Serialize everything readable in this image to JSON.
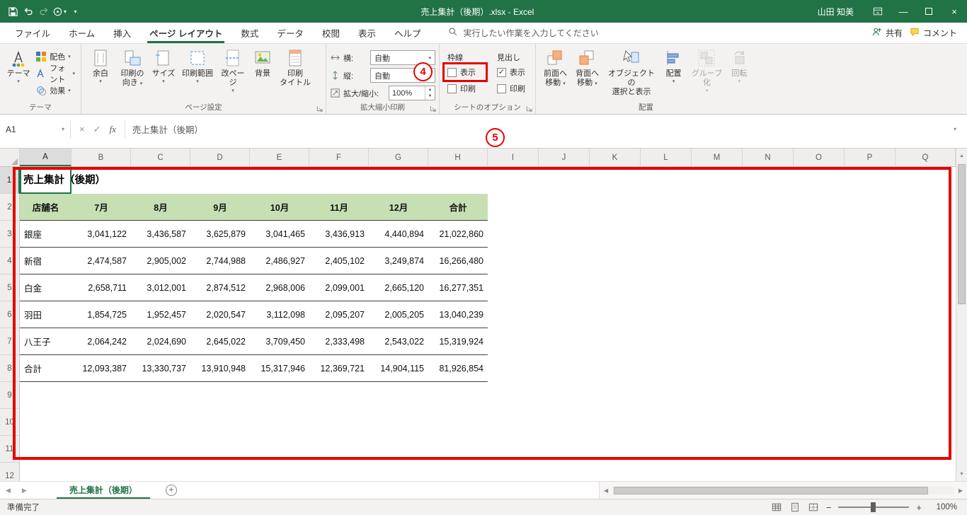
{
  "icons": {
    "caret": "▾",
    "up": "▲",
    "down": "▼",
    "left": "◀",
    "right": "▶",
    "plus": "+",
    "check": "✓",
    "cancel": "×",
    "fx": "fx",
    "minimize": "—",
    "close": "×"
  },
  "title_bar": {
    "title": "売上集計（後期）.xlsx  -  Excel",
    "user_name": "山田 知美"
  },
  "menu": {
    "tabs": [
      "ファイル",
      "ホーム",
      "挿入",
      "ページ レイアウト",
      "数式",
      "データ",
      "校閲",
      "表示",
      "ヘルプ"
    ],
    "active_tab": "ページ レイアウト",
    "search_placeholder": "実行したい作業を入力してください",
    "share": "共有",
    "comments": "コメント"
  },
  "ribbon": {
    "theme_group": {
      "label": "テーマ",
      "theme_button": "テーマ",
      "colors": "配色",
      "fonts": "フォント",
      "effects": "効果"
    },
    "page_setup_group": {
      "label": "ページ設定",
      "margins": "余白",
      "orientation_1": "印刷の",
      "orientation_2": "向き",
      "size": "サイズ",
      "print_area": "印刷範囲",
      "breaks": "改ページ",
      "background": "背景",
      "print_titles_1": "印刷",
      "print_titles_2": "タイトル"
    },
    "scale_group": {
      "label": "拡大縮小印刷",
      "width_label": "横:",
      "width_value": "自動",
      "height_label": "縦:",
      "height_value": "自動",
      "scale_label": "拡大/縮小:",
      "scale_value": "100%"
    },
    "sheet_options_group": {
      "label": "シートのオプション",
      "gridlines_label": "枠線",
      "headings_label": "見出し",
      "view_label": "表示",
      "print_label": "印刷",
      "gridlines_view_checked": false,
      "gridlines_print_checked": false,
      "headings_view_checked": true,
      "headings_print_checked": false
    },
    "arrange_group": {
      "label": "配置",
      "bring_forward_1": "前面へ",
      "bring_forward_2": "移動",
      "send_backward_1": "背面へ",
      "send_backward_2": "移動",
      "selection_pane_1": "オブジェクトの",
      "selection_pane_2": "選択と表示",
      "align": "配置",
      "group": "グループ化",
      "rotate": "回転"
    }
  },
  "formula_bar": {
    "name_box": "A1",
    "formula": "売上集計（後期）"
  },
  "grid": {
    "columns": [
      "A",
      "B",
      "C",
      "D",
      "E",
      "F",
      "G",
      "H",
      "I",
      "J",
      "K",
      "L",
      "M",
      "N",
      "O",
      "P",
      "Q"
    ],
    "row_count": 12,
    "selected_cell": "A1",
    "selected_column": "A",
    "selected_row": "1",
    "title_cell_text": "売上集計（後期）",
    "header_fill": "#c6e0b4",
    "table": {
      "header": [
        "店舗名",
        "7月",
        "8月",
        "9月",
        "10月",
        "11月",
        "12月",
        "合計"
      ],
      "rows": [
        [
          "銀座",
          "3,041,122",
          "3,436,587",
          "3,625,879",
          "3,041,465",
          "3,436,913",
          "4,440,894",
          "21,022,860"
        ],
        [
          "新宿",
          "2,474,587",
          "2,905,002",
          "2,744,988",
          "2,486,927",
          "2,405,102",
          "3,249,874",
          "16,266,480"
        ],
        [
          "白金",
          "2,658,711",
          "3,012,001",
          "2,874,512",
          "2,968,006",
          "2,099,001",
          "2,665,120",
          "16,277,351"
        ],
        [
          "羽田",
          "1,854,725",
          "1,952,457",
          "2,020,547",
          "3,112,098",
          "2,095,207",
          "2,005,205",
          "13,040,239"
        ],
        [
          "八王子",
          "2,064,242",
          "2,024,690",
          "2,645,022",
          "3,709,450",
          "2,333,498",
          "2,543,022",
          "15,319,924"
        ],
        [
          "合計",
          "12,093,387",
          "13,330,737",
          "13,910,948",
          "15,317,946",
          "12,369,721",
          "14,904,115",
          "81,926,854"
        ]
      ]
    }
  },
  "sheet_tabs": {
    "active_tab": "売上集計（後期）"
  },
  "status_bar": {
    "ready": "準備完了",
    "zoom": "100%"
  },
  "annotations": {
    "step4": "4",
    "step5": "5"
  },
  "colors": {
    "accent": "#217346",
    "annotation": "#e60000",
    "table_header": "#c6e0b4"
  }
}
